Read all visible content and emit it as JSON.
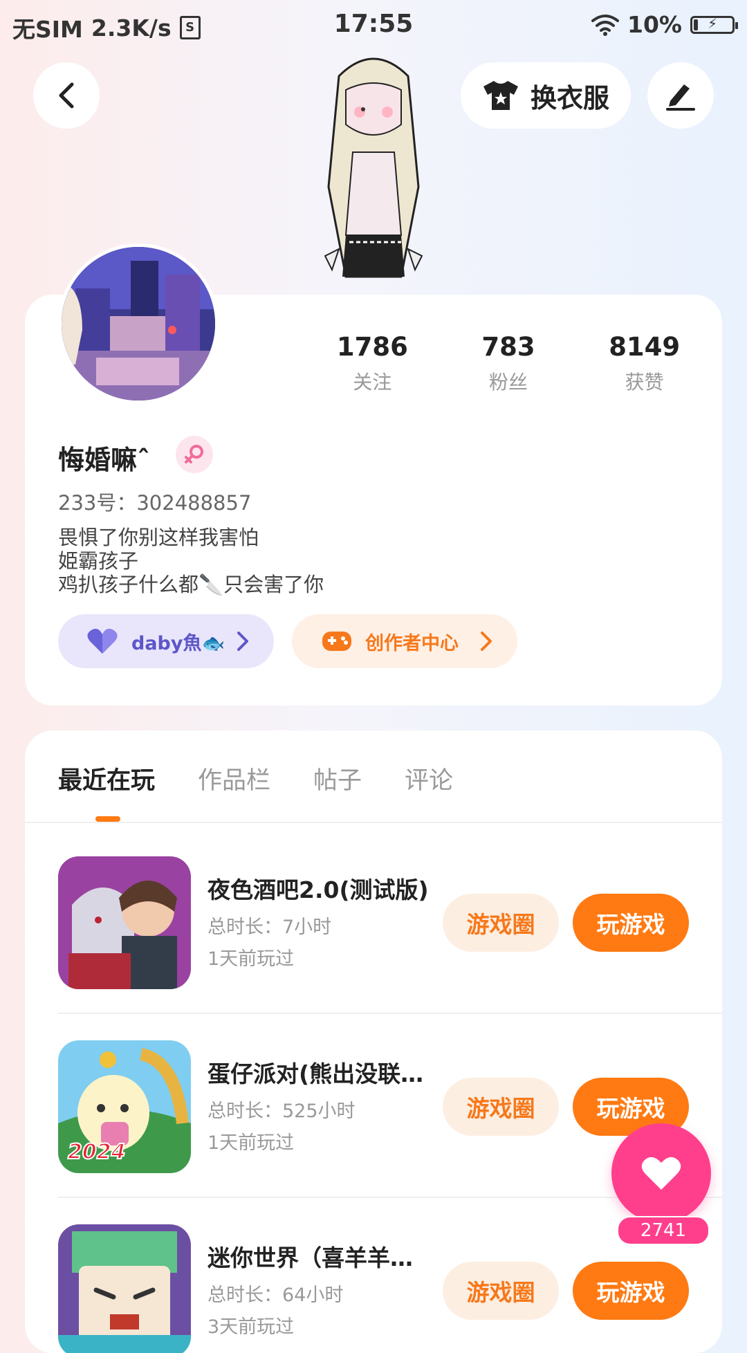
{
  "status_bar": {
    "carrier": "无SIM",
    "net_speed": "2.3K/s",
    "sim_icon_char": "S",
    "time": "17:55",
    "battery": "10%"
  },
  "header": {
    "dress_label": "换衣服"
  },
  "profile": {
    "stats": [
      {
        "value": "1786",
        "label": "关注"
      },
      {
        "value": "783",
        "label": "粉丝"
      },
      {
        "value": "8149",
        "label": "获赞"
      }
    ],
    "nickname": "悔婚嘛ˆ",
    "uid": "233号：302488857",
    "bio": [
      "畏惧了你别这样我害怕",
      "姫霸孩子",
      "鸡扒孩子什么都🔪只会害了你"
    ],
    "fan_group": "daby魚🐟",
    "creator_center": "创作者中心"
  },
  "tabs": [
    {
      "label": "最近在玩",
      "active": true
    },
    {
      "label": "作品栏",
      "active": false
    },
    {
      "label": "帖子",
      "active": false
    },
    {
      "label": "评论",
      "active": false
    }
  ],
  "games": [
    {
      "title": "夜色酒吧2.0(测试版)",
      "duration": "总时长：7小时",
      "last_played": "1天前玩过",
      "circle_label": "游戏圈",
      "play_label": "玩游戏"
    },
    {
      "title": "蛋仔派对(熊出没联…",
      "duration": "总时长：525小时",
      "last_played": "1天前玩过",
      "circle_label": "游戏圈",
      "play_label": "玩游戏"
    },
    {
      "title": "迷你世界（喜羊羊…",
      "duration": "总时长：64小时",
      "last_played": "3天前玩过",
      "circle_label": "游戏圈",
      "play_label": "玩游戏"
    }
  ],
  "game_badge": "2024",
  "like_count": "2741",
  "colors": {
    "accent": "#ff7a12",
    "accent_light": "#fdeee2",
    "like": "#ff3f8c",
    "fan_pill": "#e9e6fb"
  }
}
